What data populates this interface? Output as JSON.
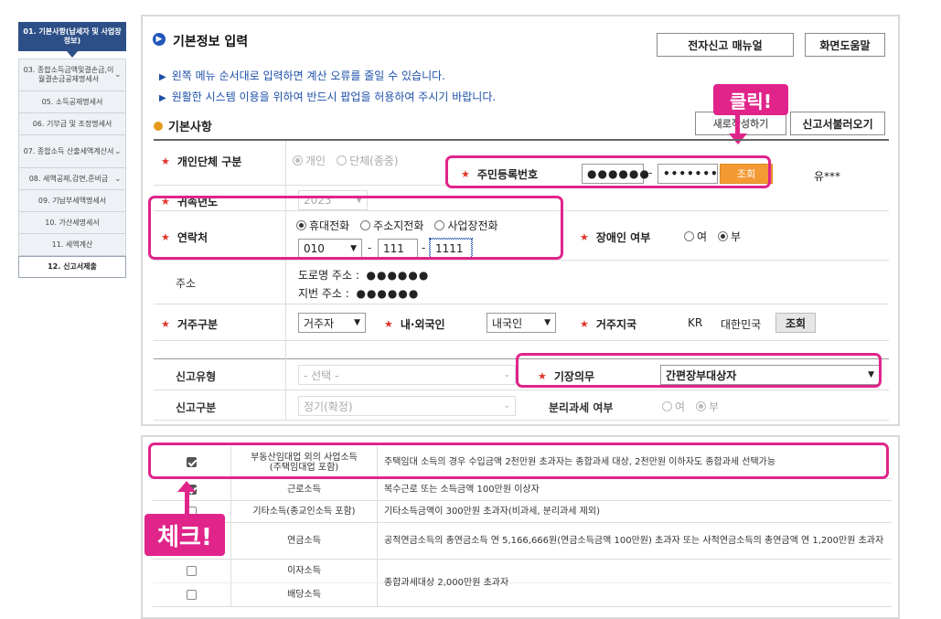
{
  "sidebar": {
    "items": [
      {
        "label": "01. 기본사항(납세자 및 사업장정보)",
        "arrow": ""
      },
      {
        "label": "03. 종합소득금액및결손금,이월결손금공제명세서",
        "arrow": "⌄"
      },
      {
        "label": "05. 소득공제명세서",
        "arrow": ""
      },
      {
        "label": "06. 기부금 및 조정명세서",
        "arrow": ""
      },
      {
        "label": "07. 종합소득 산출세액계산서",
        "arrow": "⌄"
      },
      {
        "label": "08. 세액공제,감면,준비금",
        "arrow": "⌄"
      },
      {
        "label": "09. 기납부세액명세서",
        "arrow": ""
      },
      {
        "label": "10. 가산세명세서",
        "arrow": ""
      },
      {
        "label": "11. 세액계산",
        "arrow": ""
      },
      {
        "label": "12. 신고서제출",
        "arrow": ""
      }
    ]
  },
  "header": {
    "title": "기본정보 입력",
    "btn_manual": "전자신고 매뉴얼",
    "btn_help": "화면도움말",
    "notice1": "왼쪽 메뉴 순서대로 입력하면 계산 오류를 줄일 수 있습니다.",
    "notice2": "원활한 시스템 이용을 위하여 반드시 팝업을 허용하여 주시기 바랍니다.",
    "btn_temp": "새로작성하기",
    "btn_load": "신고서불러오기"
  },
  "section": {
    "title": "기본사항"
  },
  "form": {
    "entity_type_label": "개인단체 구분",
    "entity_opt1": "개인",
    "entity_opt2": "단체(종중)",
    "rrn_label": "주민등록번호",
    "rrn_front": "●●●●●●",
    "rrn_back": "•••••••",
    "rrn_lookup": "조회",
    "name_value": "유***",
    "year_label": "귀속년도",
    "year_value": "2023",
    "contact_label": "연락처",
    "contact_opt1": "휴대전화",
    "contact_opt2": "주소지전화",
    "contact_opt3": "사업장전화",
    "phone1": "010",
    "phone2": "111",
    "phone3": "1111",
    "disabled_label": "장애인 여부",
    "disabled_yes": "여",
    "disabled_no": "부",
    "address_label": "주소",
    "road_label": "도로명 주소 :",
    "road_value": "●●●●●●",
    "lot_label": "지번 주소 :",
    "lot_value": "●●●●●●",
    "residency_label": "거주구분",
    "residency_value": "거주자",
    "nationality_label": "내·외국인",
    "nationality_value": "내국인",
    "country_label": "거주지국",
    "country_code": "KR",
    "country_name": "대한민국",
    "country_lookup": "조회",
    "report_type_label": "신고유형",
    "report_type_value": "- 선택 -",
    "bookkeeping_label": "기장의무",
    "bookkeeping_value": "간편장부대상자",
    "report_class_label": "신고구분",
    "report_class_value": "정기(확정)",
    "separate_tax_label": "분리과세 여부",
    "separate_yes": "여",
    "separate_no": "부"
  },
  "annotations": {
    "click_label": "클릭!",
    "check_label": "체크!"
  },
  "income_table": {
    "rows": [
      {
        "checked": true,
        "name": "부동산임대업 외의 사업소득\n(주택임대업 포함)",
        "desc": "주택임대 소득의 경우 수입금액 2천만원 초과자는 종합과세 대상, 2천만원 이하자도 종합과세 선택가능"
      },
      {
        "checked": true,
        "name": "근로소득",
        "desc": "복수근로 또는 소득금액 100만원 이상자"
      },
      {
        "checked": false,
        "name": "기타소득(종교인소득 포함)",
        "desc": "기타소득금액이 300만원 초과자(비과세, 분리과세 제외)"
      },
      {
        "checked": false,
        "name": "연금소득",
        "desc": "공적연금소득의 총연금소득 연 5,166,666원(연금소득금액 100만원) 초과자 또는 사적연금소득의 총연금액 연 1,200만원 초과자"
      },
      {
        "checked": false,
        "name": "이자소득",
        "desc": "종합과세대상 2,000만원 초과자"
      },
      {
        "checked": false,
        "name": "배당소득",
        "desc": ""
      }
    ]
  },
  "colors": {
    "accent": "#2d4f87",
    "highlight": "#e0248a",
    "lookup": "#f49a34",
    "notice": "#1c4fa7"
  }
}
